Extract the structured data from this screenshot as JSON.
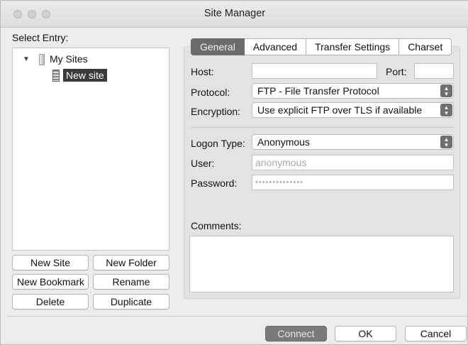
{
  "window": {
    "title": "Site Manager"
  },
  "left": {
    "select_entry_label": "Select Entry:",
    "tree": {
      "root": "My Sites",
      "child": "New site"
    },
    "buttons": {
      "new_site": "New Site",
      "new_folder": "New Folder",
      "new_bookmark": "New Bookmark",
      "rename": "Rename",
      "delete": "Delete",
      "duplicate": "Duplicate"
    }
  },
  "tabs": [
    "General",
    "Advanced",
    "Transfer Settings",
    "Charset"
  ],
  "active_tab": "General",
  "general": {
    "host_label": "Host:",
    "host_value": "",
    "port_label": "Port:",
    "port_value": "",
    "protocol_label": "Protocol:",
    "protocol_value": "FTP - File Transfer Protocol",
    "encryption_label": "Encryption:",
    "encryption_value": "Use explicit FTP over TLS if available",
    "logon_label": "Logon Type:",
    "logon_value": "Anonymous",
    "user_label": "User:",
    "user_value": "anonymous",
    "password_label": "Password:",
    "password_value": "••••••••••••••",
    "comments_label": "Comments:",
    "comments_value": ""
  },
  "footer": {
    "connect": "Connect",
    "ok": "OK",
    "cancel": "Cancel"
  }
}
